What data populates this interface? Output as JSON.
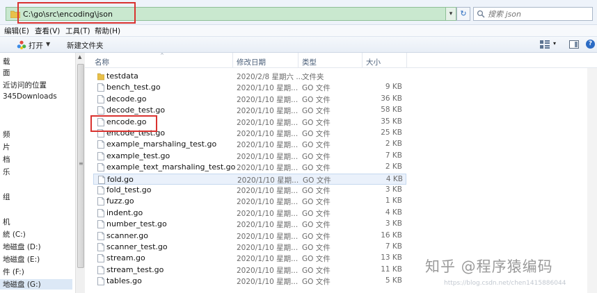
{
  "address_bar": {
    "path": "C:\\go\\src\\encoding\\json",
    "search_placeholder": "搜索 json",
    "dropdown_glyph": "▾",
    "refresh_glyph": "↻"
  },
  "menubar": {
    "items": [
      "编辑(E)",
      "查看(V)",
      "工具(T)",
      "帮助(H)"
    ]
  },
  "toolbar": {
    "open_label": "打开",
    "open_arrow": "▼",
    "new_folder_label": "新建文件夹",
    "view_arrow": "▾",
    "help_glyph": "?"
  },
  "nav": {
    "items": [
      {
        "label": "载"
      },
      {
        "label": "面"
      },
      {
        "label": "近访问的位置"
      },
      {
        "label": "345Downloads"
      },
      {
        "label": "频"
      },
      {
        "label": "片"
      },
      {
        "label": "档"
      },
      {
        "label": "乐"
      },
      {
        "label": "组"
      },
      {
        "label": "机"
      },
      {
        "label": "統 (C:)"
      },
      {
        "label": "地磁盘 (D:)"
      },
      {
        "label": "地磁盘 (E:)"
      },
      {
        "label": "件 (F:)"
      },
      {
        "label": "地磁盘 (G:)"
      }
    ],
    "scroll_up_glyph": "▲"
  },
  "columns": {
    "name": "名称",
    "date": "修改日期",
    "type": "类型",
    "size": "大小",
    "sort_glyph": "^"
  },
  "files": [
    {
      "name": "testdata",
      "date": "2020/2/8 星期六 ...",
      "type": "文件夹",
      "size": "",
      "kind": "folder"
    },
    {
      "name": "bench_test.go",
      "date": "2020/1/10 星期...",
      "type": "GO 文件",
      "size": "9 KB",
      "kind": "file"
    },
    {
      "name": "decode.go",
      "date": "2020/1/10 星期...",
      "type": "GO 文件",
      "size": "36 KB",
      "kind": "file"
    },
    {
      "name": "decode_test.go",
      "date": "2020/1/10 星期...",
      "type": "GO 文件",
      "size": "58 KB",
      "kind": "file"
    },
    {
      "name": "encode.go",
      "date": "2020/1/10 星期...",
      "type": "GO 文件",
      "size": "35 KB",
      "kind": "file"
    },
    {
      "name": "encode_test.go",
      "date": "2020/1/10 星期...",
      "type": "GO 文件",
      "size": "25 KB",
      "kind": "file"
    },
    {
      "name": "example_marshaling_test.go",
      "date": "2020/1/10 星期...",
      "type": "GO 文件",
      "size": "2 KB",
      "kind": "file"
    },
    {
      "name": "example_test.go",
      "date": "2020/1/10 星期...",
      "type": "GO 文件",
      "size": "7 KB",
      "kind": "file"
    },
    {
      "name": "example_text_marshaling_test.go",
      "date": "2020/1/10 星期...",
      "type": "GO 文件",
      "size": "2 KB",
      "kind": "file"
    },
    {
      "name": "fold.go",
      "date": "2020/1/10 星期...",
      "type": "GO 文件",
      "size": "4 KB",
      "kind": "file",
      "highlighted": true
    },
    {
      "name": "fold_test.go",
      "date": "2020/1/10 星期...",
      "type": "GO 文件",
      "size": "3 KB",
      "kind": "file"
    },
    {
      "name": "fuzz.go",
      "date": "2020/1/10 星期...",
      "type": "GO 文件",
      "size": "1 KB",
      "kind": "file"
    },
    {
      "name": "indent.go",
      "date": "2020/1/10 星期...",
      "type": "GO 文件",
      "size": "4 KB",
      "kind": "file"
    },
    {
      "name": "number_test.go",
      "date": "2020/1/10 星期...",
      "type": "GO 文件",
      "size": "3 KB",
      "kind": "file"
    },
    {
      "name": "scanner.go",
      "date": "2020/1/10 星期...",
      "type": "GO 文件",
      "size": "16 KB",
      "kind": "file"
    },
    {
      "name": "scanner_test.go",
      "date": "2020/1/10 星期...",
      "type": "GO 文件",
      "size": "7 KB",
      "kind": "file"
    },
    {
      "name": "stream.go",
      "date": "2020/1/10 星期...",
      "type": "GO 文件",
      "size": "13 KB",
      "kind": "file"
    },
    {
      "name": "stream_test.go",
      "date": "2020/1/10 星期...",
      "type": "GO 文件",
      "size": "11 KB",
      "kind": "file"
    },
    {
      "name": "tables.go",
      "date": "2020/1/10 星期...",
      "type": "GO 文件",
      "size": "5 KB",
      "kind": "file"
    }
  ],
  "watermark": {
    "logo": "知乎 @程序猿编码",
    "url": "https://blog.csdn.net/chen1415886044"
  },
  "colors": {
    "address_bg": "#c9e8cf",
    "annotation_red": "#d9322f",
    "highlight_row": "#eaf1fb",
    "folder_yellow": "#e8c04a"
  }
}
